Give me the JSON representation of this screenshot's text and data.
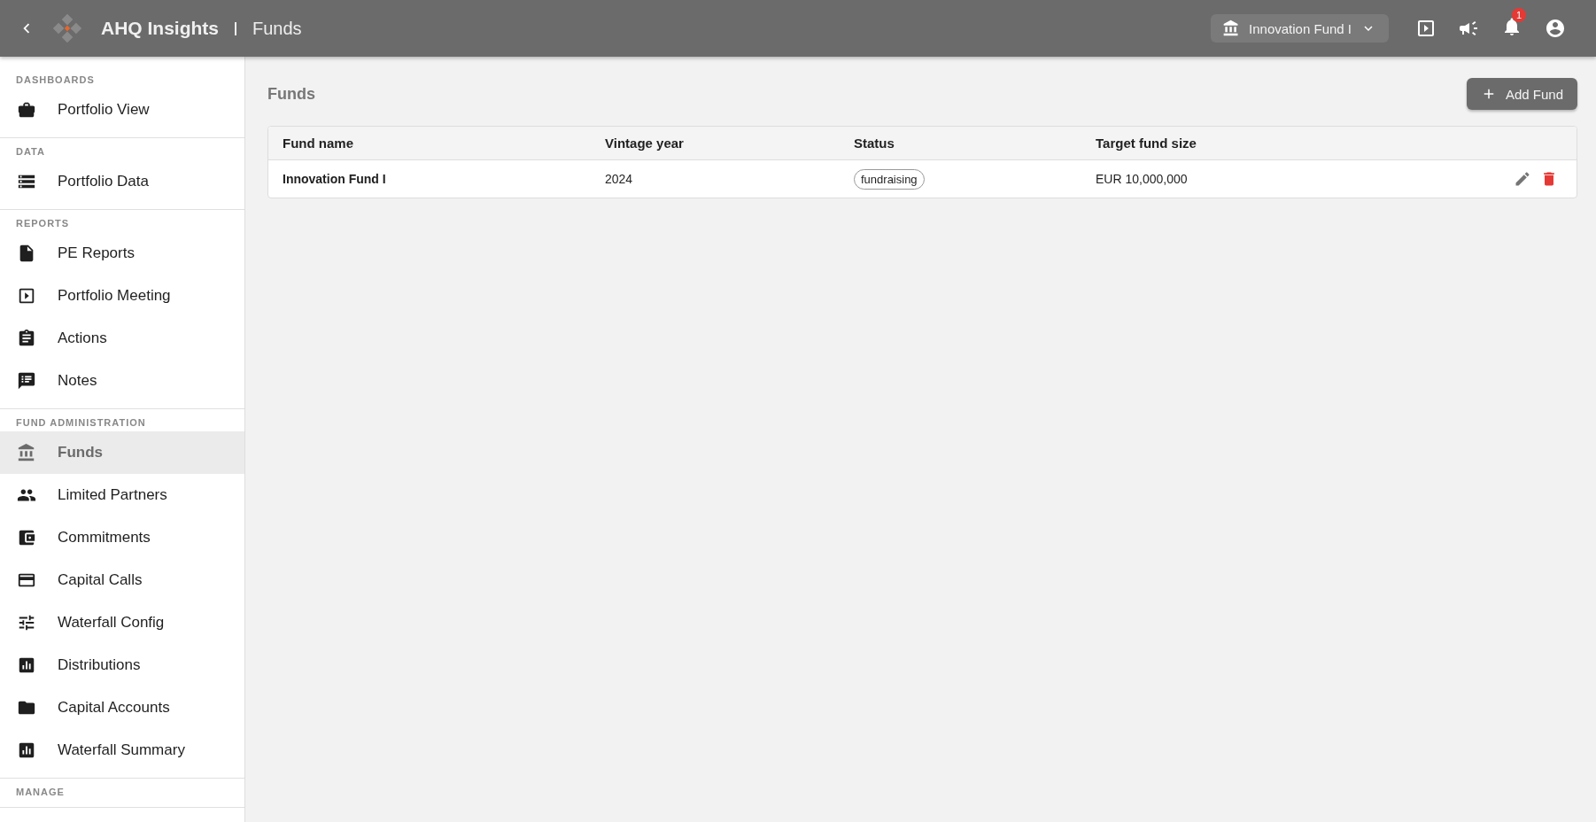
{
  "header": {
    "app_title": "AHQ Insights",
    "page_title": "Funds",
    "fund_selector": "Innovation Fund I",
    "notification_count": "1"
  },
  "sidebar": {
    "sections": [
      {
        "heading": "DASHBOARDS",
        "items": [
          {
            "label": "Portfolio View",
            "selected": false
          }
        ]
      },
      {
        "heading": "DATA",
        "items": [
          {
            "label": "Portfolio Data",
            "selected": false
          }
        ]
      },
      {
        "heading": "REPORTS",
        "items": [
          {
            "label": "PE Reports",
            "selected": false
          },
          {
            "label": "Portfolio Meeting",
            "selected": false
          },
          {
            "label": "Actions",
            "selected": false
          },
          {
            "label": "Notes",
            "selected": false
          }
        ]
      },
      {
        "heading": "FUND ADMINISTRATION",
        "items": [
          {
            "label": "Funds",
            "selected": true
          },
          {
            "label": "Limited Partners",
            "selected": false
          },
          {
            "label": "Commitments",
            "selected": false
          },
          {
            "label": "Capital Calls",
            "selected": false
          },
          {
            "label": "Waterfall Config",
            "selected": false
          },
          {
            "label": "Distributions",
            "selected": false
          },
          {
            "label": "Capital Accounts",
            "selected": false
          },
          {
            "label": "Waterfall Summary",
            "selected": false
          }
        ]
      },
      {
        "heading": "MANAGE"
      }
    ]
  },
  "main": {
    "title": "Funds",
    "add_button": "Add Fund",
    "table": {
      "columns": [
        "Fund name",
        "Vintage year",
        "Status",
        "Target fund size"
      ],
      "rows": [
        {
          "fund_name": "Innovation Fund I",
          "vintage_year": "2024",
          "status": "fundraising",
          "target_fund_size": "EUR 10,000,000"
        }
      ]
    }
  }
}
